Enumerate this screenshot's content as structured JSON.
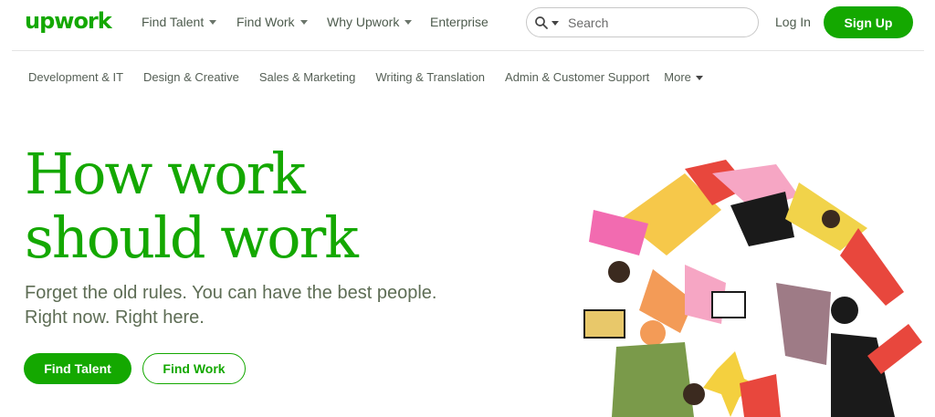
{
  "header": {
    "logo_text": "upwork",
    "nav": [
      {
        "label": "Find Talent",
        "dropdown": true
      },
      {
        "label": "Find Work",
        "dropdown": true
      },
      {
        "label": "Why Upwork",
        "dropdown": true
      },
      {
        "label": "Enterprise",
        "dropdown": false
      }
    ],
    "search": {
      "placeholder": "Search",
      "value": ""
    },
    "login_label": "Log In",
    "signup_label": "Sign Up"
  },
  "categories": {
    "items": [
      "Development & IT",
      "Design & Creative",
      "Sales & Marketing",
      "Writing & Translation",
      "Admin & Customer Support"
    ],
    "more_label": "More"
  },
  "hero": {
    "title_line1": "How work",
    "title_line2": "should work",
    "subtitle_line1": "Forget the old rules. You can have the best people.",
    "subtitle_line2": "Right now. Right here.",
    "primary_button": "Find Talent",
    "secondary_button": "Find Work"
  },
  "colors": {
    "brand": "#14a800",
    "text_muted": "#5e6d55"
  }
}
